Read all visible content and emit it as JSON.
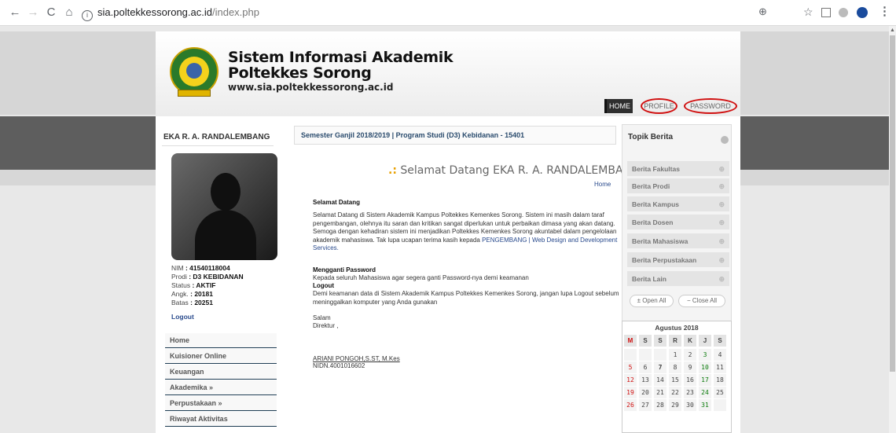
{
  "browser": {
    "url_host": "sia.poltekkessorong.ac.id",
    "url_path": "/index.php",
    "back_icon": "←",
    "forward_icon": "→",
    "reload_icon": "C",
    "home_icon": "⌂",
    "info_icon": "i",
    "zoom_icon": "⊕",
    "star_icon": "☆",
    "menu_icon": "⋮"
  },
  "header": {
    "title_line1": "Sistem Informasi Akademik",
    "title_line2": "Poltekkes Sorong",
    "website": "www.sia.poltekkessorong.ac.id",
    "nav": [
      "HOME",
      "PROFILE",
      "PASSWORD"
    ],
    "active_nav": "HOME",
    "highlight_color": "#d01010"
  },
  "student": {
    "name": "EKA R. A. RANDALEMBANG",
    "nim_label": "NIM",
    "nim": ": 41540118004",
    "prodi_label": "Prodi",
    "prodi": ": D3 KEBIDANAN",
    "status_label": "Status",
    "status": ": AKTIF",
    "angk_label": "Angk.",
    "angk": ": 20181",
    "batas_label": "Batas",
    "batas": ": 20251",
    "logout": "Logout"
  },
  "menu": [
    "Home",
    "Kuisioner Online",
    "Keuangan",
    "Akademika »",
    "Perpustakaan »",
    "Riwayat Aktivitas"
  ],
  "main": {
    "semester": "Semester Ganjil 2018/2019 | Program Studi (D3) Kebidanan - 15401",
    "welcome": "Selamat Datang EKA R. A. RANDALEMBANG",
    "home_link": "Home",
    "heading1": "Selamat Datang",
    "para1": "Selamat Datang di Sistem Akademik Kampus Poltekkes Kemenkes Sorong. Sistem ini masih dalam taraf pengembangan, olehnya itu saran dan kritikan sangat diperlukan untuk perbaikan dimasa yang akan datang. Semoga dengan kehadiran sistem ini menjadikan Poltekkes Kemenkes Sorong akuntabel dalam pengelolaan akademik mahasiswa. Tak lupa ucapan terima kasih kepada",
    "para1_link": "PENGEMBANG | Web Design and Development Services.",
    "heading2": "Mengganti Password",
    "para2": "Kepada seluruh Mahasiswa agar segera ganti Password-nya demi keamanan",
    "heading3": "Logout",
    "para3": "Demi keamanan data di Sistem Akademik Kampus Poltekkes Kemenkes Sorong, jangan lupa Logout sebelum meninggalkan komputer yang Anda gunakan",
    "salam": "Salam",
    "direktur": "Direktur ,",
    "signer": "ARIANI PONGOH,S.ST, M.Kes",
    "nidn": "NIDN.4001016602"
  },
  "berita": {
    "title": "Topik Berita",
    "items": [
      "Berita Fakultas",
      "Berita Prodi",
      "Berita Kampus",
      "Berita Dosen",
      "Berita Mahasiswa",
      "Berita Perpustakaan",
      "Berita Lain"
    ],
    "open_all": "Open All",
    "close_all": "Close All"
  },
  "calendar": {
    "title": "Agustus 2018",
    "days": [
      "M",
      "S",
      "S",
      "R",
      "K",
      "J",
      "S"
    ],
    "weeks": [
      [
        "",
        "",
        "",
        "1",
        "2",
        "3",
        "4"
      ],
      [
        "5",
        "6",
        "7",
        "8",
        "9",
        "10",
        "11"
      ],
      [
        "12",
        "13",
        "14",
        "15",
        "16",
        "17",
        "18"
      ],
      [
        "19",
        "20",
        "21",
        "22",
        "23",
        "24",
        "25"
      ],
      [
        "26",
        "27",
        "28",
        "29",
        "30",
        "31",
        ""
      ]
    ],
    "sunday_color": "#d01010",
    "friday_color": "#0a7a0a"
  }
}
